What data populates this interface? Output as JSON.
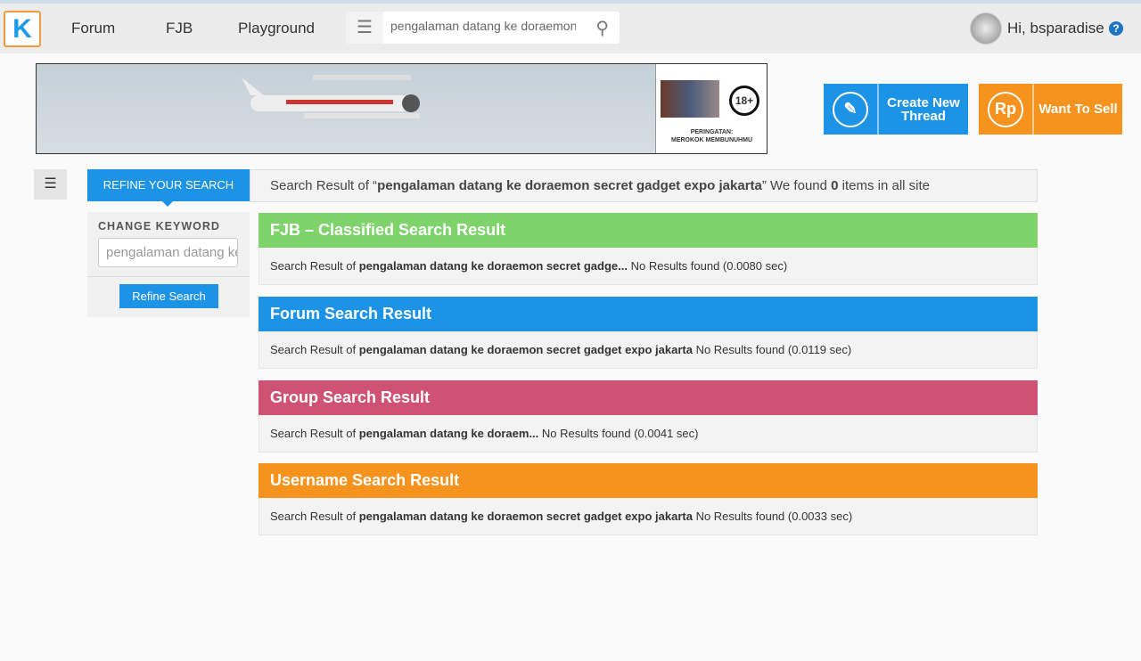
{
  "nav": {
    "links": [
      "Forum",
      "FJB",
      "Playground"
    ],
    "search_value": "pengalaman datang ke doraemon secret gadget expo jakarta",
    "greeting": "Hi, bsparadise",
    "logo": "K"
  },
  "banner": {
    "warning_line1": "PERINGATAN:",
    "warning_line2": "MEROKOK MEMBUNUHMU",
    "age": "18+"
  },
  "actions": {
    "create": "Create New Thread",
    "sell": "Want To Sell",
    "sell_icon": "Rp"
  },
  "refine": {
    "tab": "REFINE YOUR SEARCH",
    "change_keyword": "CHANGE KEYWORD",
    "keyword_value": "pengalaman datang ke doraemon secret gadget expo jakarta",
    "button": "Refine Search"
  },
  "summary": {
    "prefix": "Search Result of “",
    "query": "pengalaman datang ke doraemon secret gadget expo jakarta",
    "mid": "” We found ",
    "count": "0",
    "suffix": " items in all site"
  },
  "sections": [
    {
      "title": "FJB – Classified Search Result",
      "color": "#7ed36a",
      "prefix": "Search Result of ",
      "query": "pengalaman datang ke doraemon secret gadge...",
      "result": " No Results found (0.0080 sec)"
    },
    {
      "title": "Forum Search Result",
      "color": "#1d93e6",
      "prefix": "Search Result of ",
      "query": "pengalaman datang ke doraemon secret gadget expo jakarta",
      "result": " No Results found (0.0119 sec)"
    },
    {
      "title": "Group Search Result",
      "color": "#cf5174",
      "prefix": "Search Result of ",
      "query": "pengalaman datang ke doraem...",
      "result": " No Results found (0.0041 sec)"
    },
    {
      "title": "Username Search Result",
      "color": "#f6931e",
      "prefix": "Search Result of ",
      "query": "pengalaman datang ke doraemon secret gadget expo jakarta",
      "result": " No Results found (0.0033 sec)"
    }
  ]
}
